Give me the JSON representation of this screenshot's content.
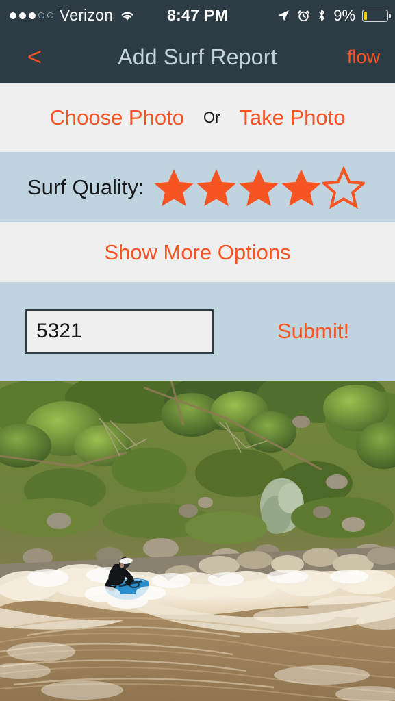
{
  "status_bar": {
    "signal_dots_filled": 3,
    "signal_dots_total": 5,
    "carrier": "Verizon",
    "wifi_icon": "wifi-icon",
    "time": "8:47 PM",
    "location_icon": "location-arrow-icon",
    "alarm_icon": "alarm-clock-icon",
    "bluetooth_icon": "bluetooth-icon",
    "battery_percent": "9%",
    "battery_icon": "battery-icon",
    "battery_fill_color": "#ffcc00",
    "background_color": "#2d3b45",
    "text_color": "#ffffff"
  },
  "nav_bar": {
    "back_label": "<",
    "back_icon": "chevron-left-icon",
    "title": "Add Surf Report",
    "right_action": "flow",
    "background_color": "#2d3b45",
    "title_color": "#c6d3da",
    "accent_color": "#f75423"
  },
  "photo_section": {
    "choose_photo_label": "Choose Photo",
    "or_label": "Or",
    "take_photo_label": "Take Photo",
    "background_color": "#efeff0"
  },
  "quality_section": {
    "label": "Surf Quality:",
    "rating": 4,
    "max_rating": 5,
    "star_color": "#f75423",
    "background_color": "#bfd4de"
  },
  "options_section": {
    "show_more_label": "Show More Options",
    "background_color": "#efeff0"
  },
  "submit_section": {
    "flow_value": "5321",
    "flow_placeholder": "Flow",
    "submit_label": "Submit!",
    "background_color": "#bfd4de",
    "input_border_color": "#2d3b45",
    "input_background_color": "#efefef"
  },
  "photo_preview": {
    "alt": "River surfer in black wetsuit riding a standing wave on a blue surfboard in muddy brown water below a green vegetated riverbank with rocks"
  }
}
